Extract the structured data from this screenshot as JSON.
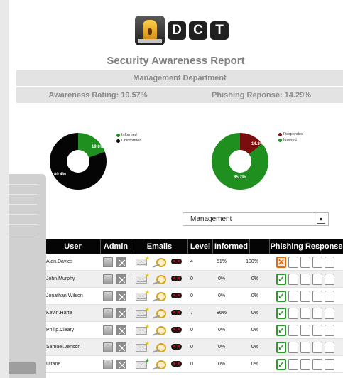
{
  "logo": {
    "letters": [
      "D",
      "C",
      "T"
    ]
  },
  "report_title": "Security Awareness Report",
  "department_label": "Management Department",
  "awareness_rating": "Awareness Rating: 19.57%",
  "phishing_response": "Phishing Reponse: 14.29%",
  "charts": [
    {
      "legend": [
        "Informed",
        "Uninformed"
      ],
      "slices": [
        {
          "label": "19.6%",
          "value": 19.6,
          "color": "#1f8f1f"
        },
        {
          "label": "80.4%",
          "value": 80.4,
          "color": "#050505"
        }
      ]
    },
    {
      "legend": [
        "Responded",
        "Ignored"
      ],
      "slices": [
        {
          "label": "14.3%",
          "value": 14.3,
          "color": "#7a0e0e"
        },
        {
          "label": "85.7%",
          "value": 85.7,
          "color": "#1f8f1f"
        }
      ]
    }
  ],
  "filter": {
    "selected": "Management"
  },
  "table": {
    "headers": {
      "clipped": "k",
      "user": "User",
      "admin": "Admin",
      "emails": "Emails",
      "level": "Level",
      "informed": "Informed",
      "phishing": "Phishing Response"
    },
    "rows": [
      {
        "user": "Alan.Davies",
        "level": "4",
        "informed": "51%",
        "pct": "100%",
        "response": "ignored"
      },
      {
        "user": "John.Murphy",
        "level": "0",
        "informed": "0%",
        "pct": "0%",
        "response": "responded"
      },
      {
        "user": "Jonathan.Wilson",
        "level": "0",
        "informed": "0%",
        "pct": "0%",
        "response": "responded"
      },
      {
        "user": "Kevin.Harte",
        "level": "7",
        "informed": "86%",
        "pct": "0%",
        "response": "responded"
      },
      {
        "user": "Philip.Cleary",
        "level": "0",
        "informed": "0%",
        "pct": "0%",
        "response": "responded"
      },
      {
        "user": "Samuel.Jenson",
        "level": "0",
        "informed": "0%",
        "pct": "0%",
        "response": "responded"
      },
      {
        "user": "Ultane",
        "level": "0",
        "informed": "0%",
        "pct": "0%",
        "response": "responded"
      }
    ]
  },
  "icons": {
    "check": "✓",
    "cross": "✕",
    "dropdown": "▾",
    "star": "★"
  },
  "colors": {
    "informed": "#1f8f1f",
    "uninformed": "#050505",
    "responded": "#7a0e0e",
    "check": "#2e9a2e",
    "cross": "#e06b10"
  }
}
